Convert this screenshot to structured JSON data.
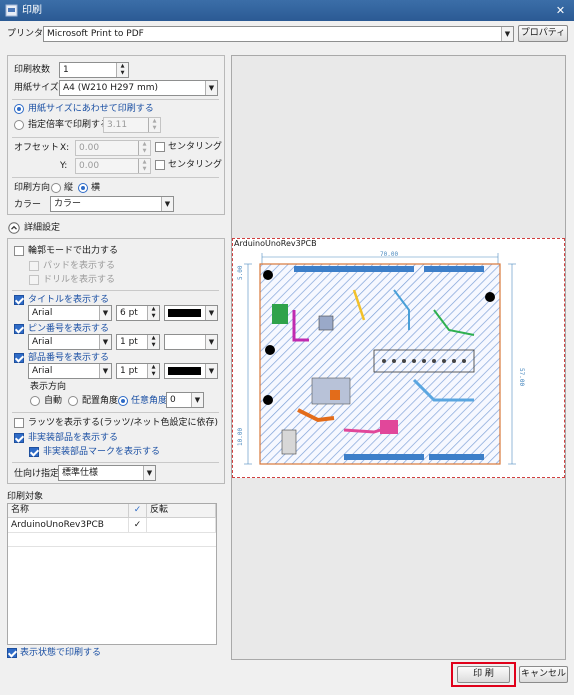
{
  "window": {
    "title": "印刷",
    "close": "✕"
  },
  "printer": {
    "label": "プリンタ",
    "value": "Microsoft Print to PDF",
    "properties_button": "プロパティ"
  },
  "settings": {
    "copies_label": "印刷枚数",
    "copies_value": "1",
    "paper_label": "用紙サイズ",
    "paper_value": "A4 (W210 H297 mm)",
    "fit_label": "用紙サイズにあわせて印刷する",
    "scale_label": "指定倍率で印刷する",
    "scale_value": "3.11",
    "offset_label": "オフセット",
    "offset_x_label": "X:",
    "offset_x_value": "0.00",
    "offset_y_label": "Y:",
    "offset_y_value": "0.00",
    "center_x_label": "センタリング",
    "center_y_label": "センタリング",
    "orientation_label": "印刷方向",
    "portrait_label": "縦",
    "landscape_label": "横",
    "color_label": "カラー",
    "color_value": "カラー"
  },
  "details": {
    "toggle_label": "詳細設定",
    "outline_label": "輪郭モードで出力する",
    "pad_label": "パッドを表示する",
    "drill_label": "ドリルを表示する",
    "title_label": "タイトルを表示する",
    "pin_label": "ピン番号を表示する",
    "part_label": "部品番号を表示する",
    "font": "Arial",
    "title_size": "6 pt",
    "pin_size": "1 pt",
    "part_size": "1 pt",
    "direction_label": "表示方向",
    "auto_label": "自動",
    "placement_label": "配置角度",
    "any_label": "任意角度",
    "angle_value": "0",
    "ratsnest_label": "ラッツを表示する(ラッツ/ネット色設定に依存)",
    "unmounted_label": "非実装部品を表示する",
    "unmounted_mark_label": "非実装部品マークを表示する",
    "spec_label": "仕向け指定",
    "spec_value": "標準仕様"
  },
  "targets": {
    "label": "印刷対象",
    "columns": [
      "名称",
      "✓",
      "反転"
    ],
    "rows": [
      {
        "name": "ArduinoUnoRev3PCB",
        "check": "✓",
        "invert": ""
      }
    ]
  },
  "print_visible_label": "表示状態で印刷する",
  "preview": {
    "title": "ArduinoUnoRev3PCB",
    "dim_width": "70.00",
    "dim_height": "57.00",
    "dim_small1": "10.00",
    "dim_small2": "5.00"
  },
  "buttons": {
    "print": "印 刷",
    "cancel": "キャンセル"
  },
  "colors": {
    "accent": "#2e6bc7",
    "highlight": "#e0001a"
  }
}
